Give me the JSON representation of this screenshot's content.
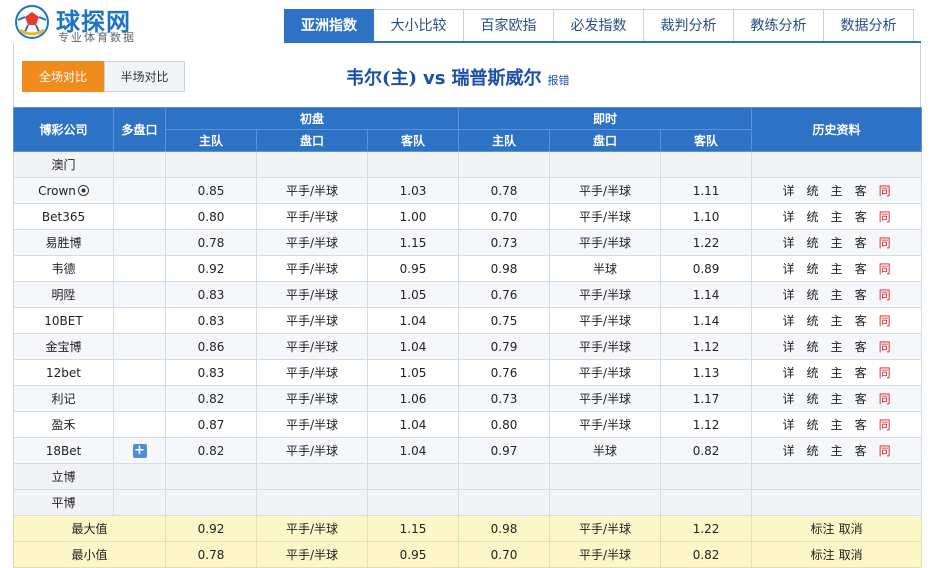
{
  "brand": {
    "name": "球探网",
    "slogan": "专业体育数据"
  },
  "tabs": [
    {
      "label": "亚洲指数",
      "active": true
    },
    {
      "label": "大小比较",
      "active": false
    },
    {
      "label": "百家欧指",
      "active": false
    },
    {
      "label": "必发指数",
      "active": false
    },
    {
      "label": "裁判分析",
      "active": false
    },
    {
      "label": "教练分析",
      "active": false
    },
    {
      "label": "数据分析",
      "active": false
    }
  ],
  "compare": {
    "full": "全场对比",
    "half": "半场对比"
  },
  "match": {
    "home": "韦尔(主)",
    "vs": "vs",
    "away": "瑞普斯威尔",
    "report_error": "报错"
  },
  "headers": {
    "company": "博彩公司",
    "multi": "多盘口",
    "initial": "初盘",
    "live": "即时",
    "history": "历史资料",
    "home": "主队",
    "line": "盘口",
    "away": "客队"
  },
  "link_labels": {
    "detail": "详",
    "stats": "统",
    "home": "主",
    "away": "客",
    "same": "同"
  },
  "rows": [
    {
      "company": "澳门",
      "blank": true
    },
    {
      "company": "Crown",
      "icon": "soccer-ball-icon",
      "i_home": "0.85",
      "i_line": "平手/半球",
      "i_away": "1.03",
      "l_home": "0.78",
      "l_line": "平手/半球",
      "l_away": "1.11"
    },
    {
      "company": "Bet365",
      "i_home": "0.80",
      "i_line": "平手/半球",
      "i_away": "1.00",
      "l_home": "0.70",
      "l_line": "平手/半球",
      "l_away": "1.10"
    },
    {
      "company": "易胜博",
      "i_home": "0.78",
      "i_line": "平手/半球",
      "i_away": "1.15",
      "l_home": "0.73",
      "l_line": "平手/半球",
      "l_away": "1.22"
    },
    {
      "company": "韦德",
      "i_home": "0.92",
      "i_line": "平手/半球",
      "i_away": "0.95",
      "l_home": "0.98",
      "l_line": "半球",
      "l_away": "0.89"
    },
    {
      "company": "明陞",
      "i_home": "0.83",
      "i_line": "平手/半球",
      "i_away": "1.05",
      "l_home": "0.76",
      "l_line": "平手/半球",
      "l_away": "1.14"
    },
    {
      "company": "10BET",
      "i_home": "0.83",
      "i_line": "平手/半球",
      "i_away": "1.04",
      "l_home": "0.75",
      "l_line": "平手/半球",
      "l_away": "1.14"
    },
    {
      "company": "金宝博",
      "i_home": "0.86",
      "i_line": "平手/半球",
      "i_away": "1.04",
      "l_home": "0.79",
      "l_line": "平手/半球",
      "l_away": "1.12"
    },
    {
      "company": "12bet",
      "i_home": "0.83",
      "i_line": "平手/半球",
      "i_away": "1.05",
      "l_home": "0.76",
      "l_line": "平手/半球",
      "l_away": "1.13"
    },
    {
      "company": "利记",
      "i_home": "0.82",
      "i_line": "平手/半球",
      "i_away": "1.06",
      "l_home": "0.73",
      "l_line": "平手/半球",
      "l_away": "1.17"
    },
    {
      "company": "盈禾",
      "i_home": "0.87",
      "i_line": "平手/半球",
      "i_away": "1.04",
      "l_home": "0.80",
      "l_line": "平手/半球",
      "l_away": "1.12"
    },
    {
      "company": "18Bet",
      "multi": "+",
      "i_home": "0.82",
      "i_line": "平手/半球",
      "i_away": "1.04",
      "l_home": "0.97",
      "l_line": "半球",
      "l_away": "0.82"
    },
    {
      "company": "立博",
      "blank": true
    },
    {
      "company": "平博",
      "blank": true
    }
  ],
  "summary": [
    {
      "label": "最大值",
      "i_home": "0.92",
      "i_line": "平手/半球",
      "i_away": "1.15",
      "l_home": "0.98",
      "l_line": "平手/半球",
      "l_away": "1.22",
      "mark": "标注",
      "cancel": "取消"
    },
    {
      "label": "最小值",
      "i_home": "0.78",
      "i_line": "平手/半球",
      "i_away": "0.95",
      "l_home": "0.70",
      "l_line": "平手/半球",
      "l_away": "0.82",
      "mark": "标注",
      "cancel": "取消"
    }
  ],
  "colors": {
    "accent": "#2d72c4",
    "orange": "#f08c1e",
    "same_link": "#d21e1e",
    "summary_bg": "#fdf6c8"
  }
}
